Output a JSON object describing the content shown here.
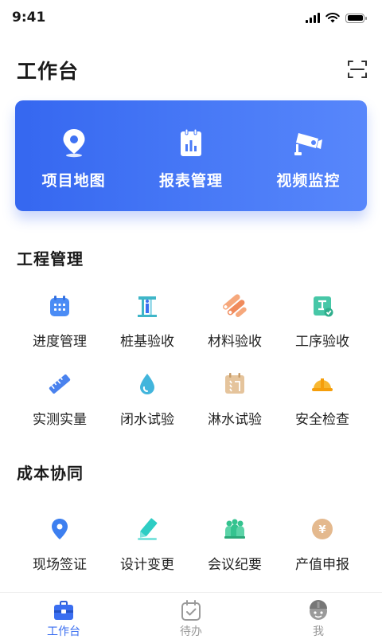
{
  "status_bar": {
    "time": "9:41"
  },
  "header": {
    "title": "工作台",
    "scan_icon": "scan-icon"
  },
  "banner": {
    "items": [
      {
        "label": "项目地图",
        "icon": "map-pin-icon"
      },
      {
        "label": "报表管理",
        "icon": "report-icon"
      },
      {
        "label": "视频监控",
        "icon": "camera-icon"
      }
    ]
  },
  "sections": [
    {
      "title": "工程管理",
      "items": [
        {
          "label": "进度管理",
          "icon": "calendar-icon"
        },
        {
          "label": "桩基验收",
          "icon": "pile-foundation-icon"
        },
        {
          "label": "材料验收",
          "icon": "materials-icon"
        },
        {
          "label": "工序验收",
          "icon": "process-check-icon"
        },
        {
          "label": "实测实量",
          "icon": "ruler-icon"
        },
        {
          "label": "闭水试验",
          "icon": "water-drop-icon"
        },
        {
          "label": "淋水试验",
          "icon": "shower-icon"
        },
        {
          "label": "安全检查",
          "icon": "helmet-icon"
        }
      ]
    },
    {
      "title": "成本协同",
      "items": [
        {
          "label": "现场签证",
          "icon": "location-icon"
        },
        {
          "label": "设计变更",
          "icon": "edit-icon"
        },
        {
          "label": "会议纪要",
          "icon": "meeting-icon"
        },
        {
          "label": "产值申报",
          "icon": "yuan-coin-icon"
        }
      ]
    }
  ],
  "tab_bar": {
    "tabs": [
      {
        "label": "工作台",
        "icon": "briefcase-icon",
        "active": true
      },
      {
        "label": "待办",
        "icon": "todo-icon",
        "active": false
      },
      {
        "label": "我",
        "icon": "profile-icon",
        "active": false
      }
    ]
  },
  "colors": {
    "primary": "#3a6ef0",
    "banner_start": "#3567f0",
    "banner_end": "#5887fb"
  }
}
